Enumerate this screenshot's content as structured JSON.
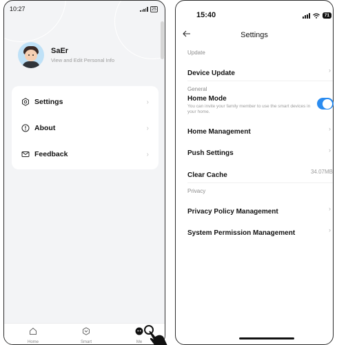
{
  "left": {
    "status": {
      "time": "10:27",
      "battery": "25"
    },
    "profile": {
      "name": "SaEr",
      "subtitle": "View and Edit Personal Info"
    },
    "menu": [
      {
        "label": "Settings",
        "icon": "gear-icon"
      },
      {
        "label": "About",
        "icon": "info-icon"
      },
      {
        "label": "Feedback",
        "icon": "mail-icon"
      }
    ],
    "tabs": [
      {
        "label": "Home",
        "icon": "home-icon"
      },
      {
        "label": "Smart",
        "icon": "smart-icon"
      },
      {
        "label": "Me",
        "icon": "me-icon"
      }
    ]
  },
  "right": {
    "status": {
      "time": "15:40",
      "battery": "71"
    },
    "title": "Settings",
    "sections": {
      "update": "Update",
      "general": "General",
      "privacy": "Privacy"
    },
    "rows": {
      "device_update": "Device Update",
      "home_mode": "Home Mode",
      "home_mode_desc": "You can invite your family member to use the smart devices in your home.",
      "home_mode_enabled": true,
      "home_management": "Home Management",
      "push_settings": "Push Settings",
      "clear_cache": "Clear Cache",
      "cache_size": "34.07MB",
      "privacy_policy": "Privacy Policy Management",
      "system_permission": "System Permission Management"
    }
  },
  "colors": {
    "accent": "#2b8cf0",
    "left_background": "#f3f4f6"
  }
}
